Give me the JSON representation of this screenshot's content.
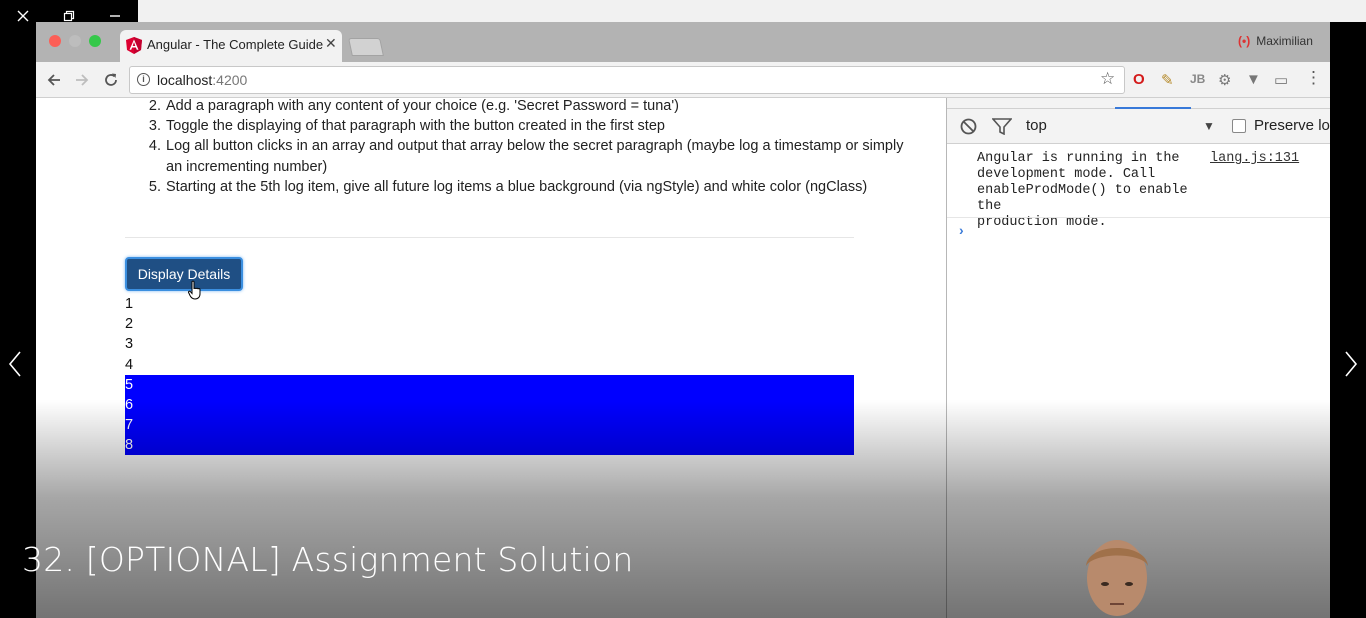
{
  "player": {
    "window_controls": [
      "close",
      "restore",
      "minimize"
    ],
    "caption": "32. [OPTIONAL] Assignment Solution",
    "nav": [
      "previous",
      "next"
    ]
  },
  "browser": {
    "tab_title": "Angular - The Complete Guide",
    "profile_name": "Maximilian",
    "url_host": "localhost",
    "url_port": ":4200"
  },
  "page": {
    "steps": [
      {
        "n": 2,
        "text": "Add a paragraph with any content of your choice (e.g. 'Secret Password = tuna')"
      },
      {
        "n": 3,
        "text": "Toggle the displaying of that paragraph with the button created in the first step"
      },
      {
        "n": 4,
        "text": "Log all button clicks in an array and output that array below the secret paragraph (maybe log a timestamp or simply an incrementing number)"
      },
      {
        "n": 5,
        "text": "Starting at the 5th log item, give all future log items a blue background (via ngStyle) and white color (ngClass)"
      }
    ],
    "button_label": "Display Details",
    "log_items": [
      "1",
      "2",
      "3",
      "4",
      "5",
      "6",
      "7",
      "8"
    ],
    "highlight_from": 5,
    "highlight_color": "#0000ff"
  },
  "devtools": {
    "context": "top",
    "preserve_label": "Preserve lo",
    "message": "Angular is running in the\ndevelopment mode. Call\nenableProdMode() to enable the\nproduction mode.",
    "source": "lang.js:131"
  }
}
